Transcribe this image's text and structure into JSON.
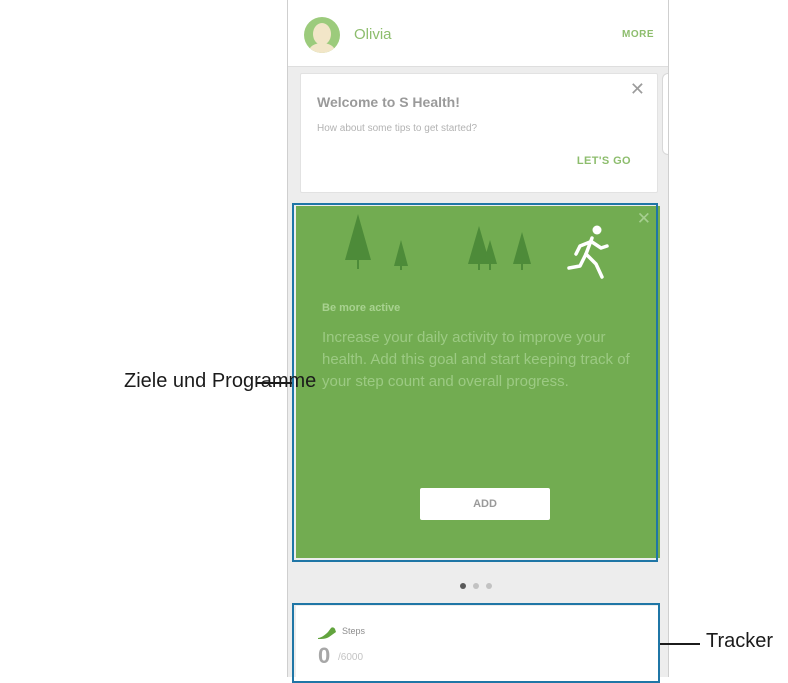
{
  "header": {
    "user_name": "Olivia",
    "more_label": "MORE",
    "avatar_icon": "user-avatar-icon"
  },
  "welcome_card": {
    "title": "Welcome to S Health!",
    "subtitle": "How about some tips to get started?",
    "action_label": "LET'S GO",
    "close_icon": "close-icon"
  },
  "goal_card": {
    "title": "Be more active",
    "description": "Increase your daily activity to improve your health. Add this goal and start keeping track of your step count and overall progress.",
    "add_label": "ADD",
    "close_icon": "close-icon",
    "background_color": "#72ac51"
  },
  "pager": {
    "page_count": 3,
    "active_index": 0
  },
  "tracker_card": {
    "label": "Steps",
    "value": "0",
    "unit": "/6000",
    "icon": "shoe-icon"
  },
  "callouts": {
    "goals": "Ziele und Programme",
    "tracker": "Tracker"
  },
  "colors": {
    "accent_green": "#8dbd6d",
    "highlight_frame": "#1f76a6"
  }
}
